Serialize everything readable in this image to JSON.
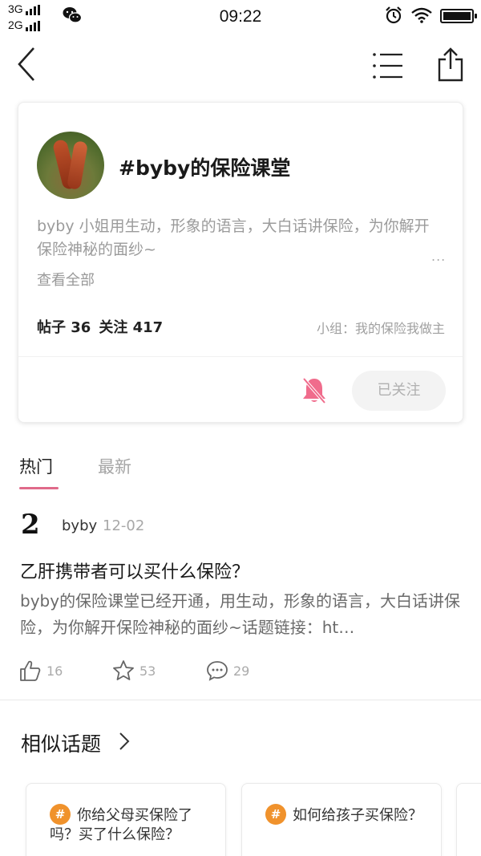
{
  "status_bar": {
    "net_1": "3G",
    "net_2": "2G",
    "time": "09:22"
  },
  "nav": {
    "back_icon": "back-arrow-icon",
    "menu_icon": "list-menu-icon",
    "share_icon": "share-icon"
  },
  "topic": {
    "title": "#byby的保险课堂",
    "description": "byby 小姐用生动，形象的语言，大白话讲保险，为你解开保险神秘的面纱~",
    "more": "...",
    "see_all": "查看全部",
    "posts": "帖子 36",
    "follows": "关注 417",
    "group": "小组：我的保险我做主",
    "follow_button": "已关注",
    "mute_icon": "bell-mute-icon",
    "accent_color": "#f06c8c"
  },
  "tabs": [
    {
      "label": "热门",
      "active": true
    },
    {
      "label": "最新",
      "active": false
    }
  ],
  "post": {
    "avatar_char": "2",
    "author": "byby",
    "date": "12-02",
    "title": "乙肝携带者可以买什么保险？",
    "body": "byby的保险课堂已经开通，用生动，形象的语言，大白话讲保险，为你解开保险神秘的面纱~话题链接：ht…",
    "likes": "16",
    "favorites": "53",
    "comments": "29"
  },
  "similar": {
    "title": "相似话题",
    "items": [
      {
        "label": "你给父母买保险了吗？买了什么保险？"
      },
      {
        "label": "如何给孩子买保险？"
      }
    ]
  }
}
